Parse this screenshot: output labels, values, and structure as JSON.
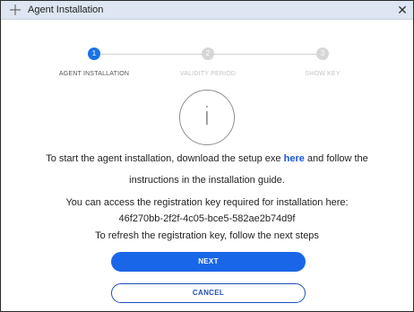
{
  "window": {
    "title": "Agent Installation",
    "title_icon": "plus-icon",
    "close_icon": "close-icon",
    "close_glyph": "✕"
  },
  "stepper": {
    "steps": [
      {
        "number": "1",
        "label": "AGENT INSTALLATION",
        "state": "active"
      },
      {
        "number": "2",
        "label": "VALIDITY PERIOD",
        "state": "inactive"
      },
      {
        "number": "3",
        "label": "SHOW KEY",
        "state": "inactive"
      }
    ]
  },
  "info": {
    "icon": "info-icon",
    "glyph": "i"
  },
  "message": {
    "line1_before": "To start the agent installation, download the setup exe ",
    "link_text": "here",
    "line1_after": " and follow the",
    "line2": "instructions in the installation guide.",
    "line3": "You can access the registration key required for installation here:",
    "registration_key": "46f270bb-2f2f-4c05-bce5-582ae2b74d9f",
    "line5": "To refresh the registration key, follow the next steps"
  },
  "buttons": {
    "next_label": "NEXT",
    "cancel_label": "CANCEL"
  },
  "colors": {
    "accent": "#1a66e8",
    "titlebar_bg": "#dde6f2",
    "inactive_step": "#d6d6d6",
    "link": "#1a57d6"
  }
}
